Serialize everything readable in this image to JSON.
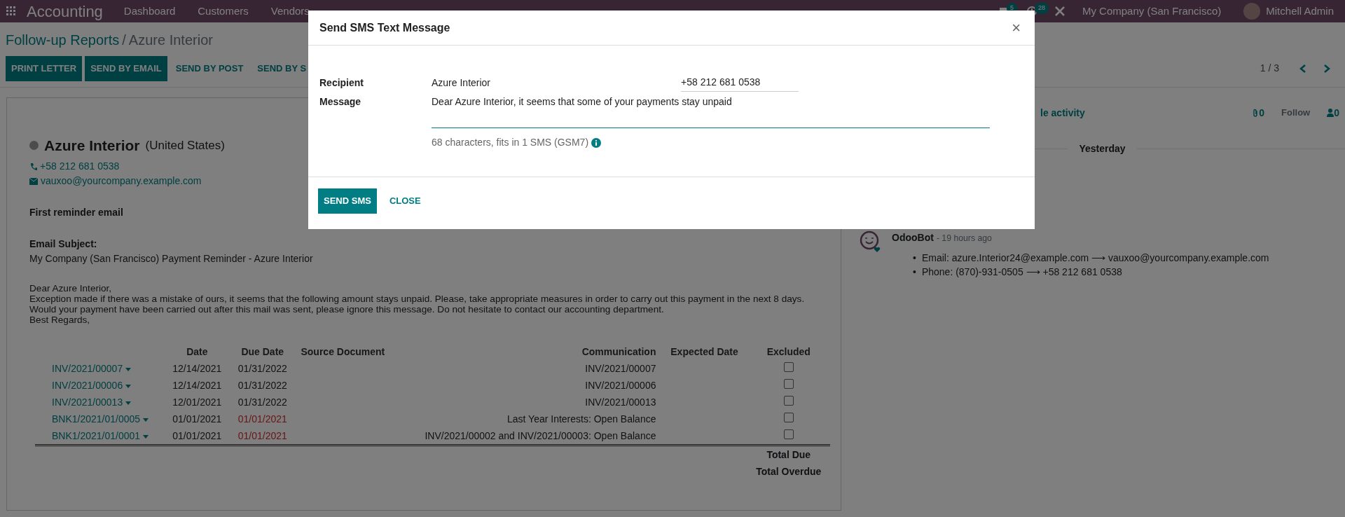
{
  "navbar": {
    "app_title": "Accounting",
    "menu": [
      "Dashboard",
      "Customers",
      "Vendors"
    ],
    "notifications": [
      {
        "kind": "chat",
        "count": "5"
      },
      {
        "kind": "activity",
        "count": "28"
      }
    ],
    "company": "My Company (San Francisco)",
    "user": "Mitchell Admin"
  },
  "breadcrumb": [
    {
      "label": "Follow-up Reports",
      "link": true
    },
    {
      "label": "/",
      "link": false
    },
    {
      "label": "Azure Interior",
      "link": false
    }
  ],
  "actions": [
    {
      "label": "PRINT LETTER",
      "primary": true
    },
    {
      "label": "SEND BY EMAIL",
      "primary": true
    },
    {
      "label": "SEND BY POST",
      "primary": false
    },
    {
      "label": "SEND BY S",
      "primary": false
    }
  ],
  "pager": "1 / 3",
  "report": {
    "partner": "Azure Interior",
    "country": "(United States)",
    "phone": "+58 212 681 0538",
    "email": "vauxoo@yourcompany.example.com",
    "level_title": "First reminder email",
    "subject_label": "Email Subject:",
    "subject": "My Company (San Francisco) Payment Reminder - Azure Interior",
    "letter": [
      "Dear Azure Interior,",
      "Exception made if there was a mistake of ours, it seems that the following amount stays unpaid. Please, take appropriate measures in order to carry out this payment in the next 8 days.",
      "Would your payment have been carried out after this mail was sent, please ignore this message. Do not hesitate to contact our accounting department.",
      "Best Regards,"
    ],
    "table": {
      "columns": [
        "Date",
        "Due Date",
        "Source Document",
        "Communication",
        "Expected Date",
        "Excluded"
      ],
      "rows": [
        {
          "reference": "INV/2021/00007",
          "date": "12/14/2021",
          "due_date": "01/31/2022",
          "overdue": false,
          "communication": "INV/2021/00007",
          "excluded": false
        },
        {
          "reference": "INV/2021/00006",
          "date": "12/14/2021",
          "due_date": "01/31/2022",
          "overdue": false,
          "communication": "INV/2021/00006",
          "excluded": false
        },
        {
          "reference": "INV/2021/00013",
          "date": "12/01/2021",
          "due_date": "01/31/2022",
          "overdue": false,
          "communication": "INV/2021/00013",
          "excluded": false
        },
        {
          "reference": "BNK1/2021/01/0005",
          "date": "01/01/2021",
          "due_date": "01/01/2021",
          "overdue": true,
          "communication": "Last Year Interests: Open Balance",
          "excluded": false
        },
        {
          "reference": "BNK1/2021/01/0001",
          "date": "01/01/2021",
          "due_date": "01/01/2021",
          "overdue": true,
          "communication": "INV/2021/00002 and INV/2021/00003: Open Balance",
          "excluded": false
        }
      ],
      "totals": [
        "Total Due",
        "Total Overdue"
      ]
    }
  },
  "chatter": {
    "activity_link": "le activity",
    "attachments": "0",
    "follow": "Follow",
    "followers": "0",
    "date_separator": "Yesterday",
    "messages": [
      {
        "author": "OdooBot",
        "time": "- 19 hours ago",
        "changes": [
          {
            "bullet": "•",
            "text": "Email: azure.Interior24@example.com ⟶ vauxoo@yourcompany.example.com"
          },
          {
            "bullet": "•",
            "text": "Phone: (870)-931-0505 ⟶ +58 212 681 0538"
          }
        ]
      }
    ]
  },
  "dialog": {
    "title": "Send SMS Text Message",
    "close": "×",
    "recipient_label": "Recipient",
    "recipient_name": "Azure Interior",
    "recipient_phone": "+58 212 681 0538",
    "message_label": "Message",
    "message": "Dear Azure Interior, it seems that some of your payments stay unpaid",
    "hint": "68 characters, fits in 1 SMS (GSM7)",
    "buttons": [
      {
        "label": "SEND SMS",
        "primary": true
      },
      {
        "label": "CLOSE",
        "primary": false
      }
    ]
  }
}
